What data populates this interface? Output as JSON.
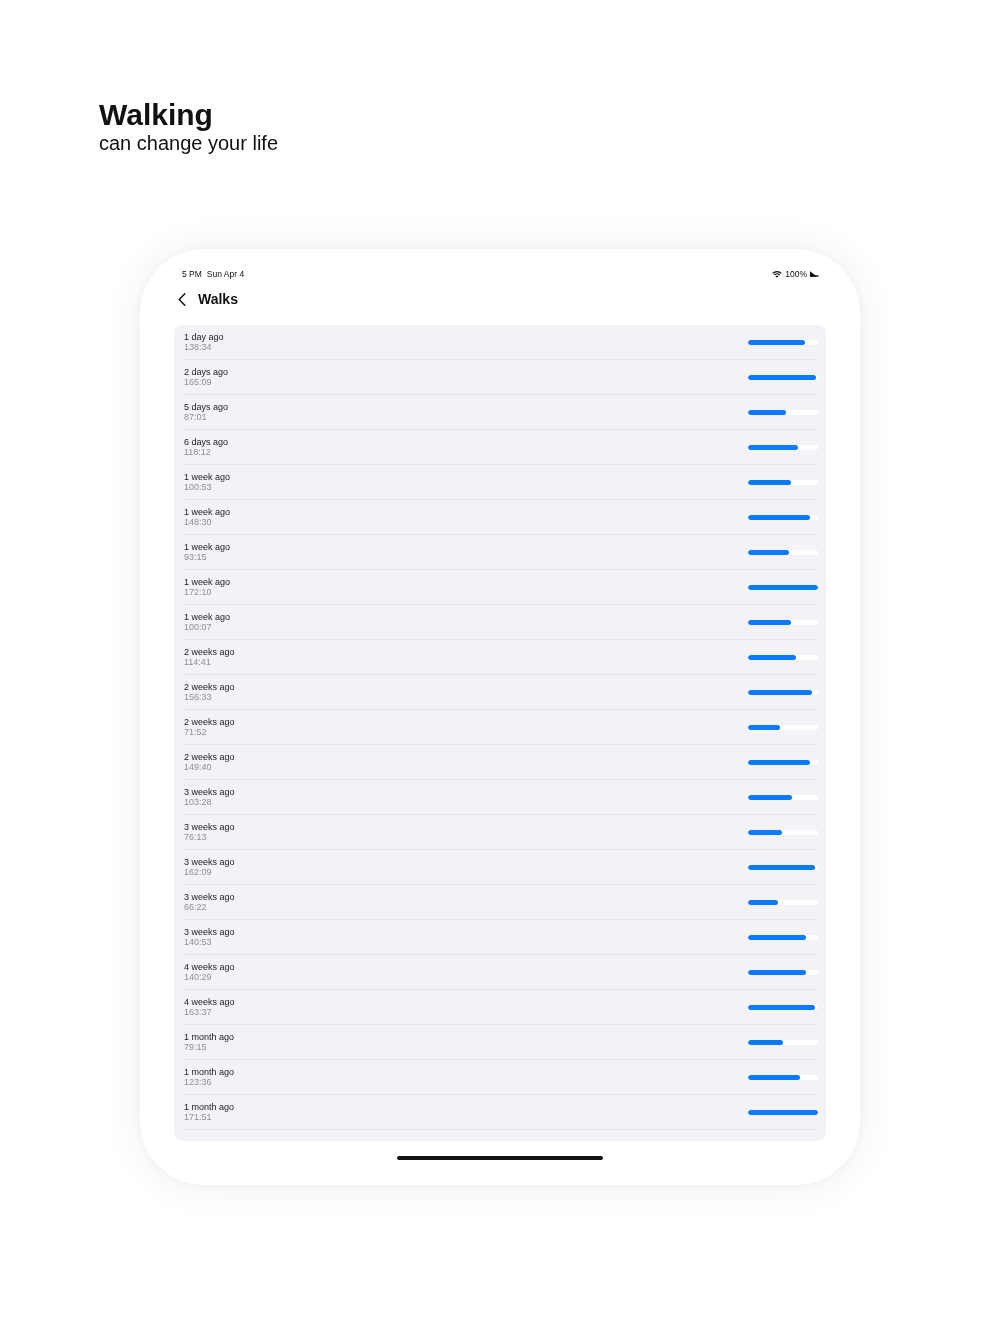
{
  "header": {
    "title": "Walking",
    "subtitle": "can change your life"
  },
  "status_bar": {
    "time": "5 PM",
    "date": "Sun Apr 4",
    "battery": "100%"
  },
  "nav": {
    "title": "Walks"
  },
  "walks": [
    {
      "when": "1 day ago",
      "duration": "138:34",
      "level": 0.82
    },
    {
      "when": "2 days ago",
      "duration": "165:09",
      "level": 0.97
    },
    {
      "when": "5 days ago",
      "duration": "87:01",
      "level": 0.54
    },
    {
      "when": "6 days ago",
      "duration": "118:12",
      "level": 0.71
    },
    {
      "when": "1 week ago",
      "duration": "100:53",
      "level": 0.62
    },
    {
      "when": "1 week ago",
      "duration": "148:30",
      "level": 0.88
    },
    {
      "when": "1 week ago",
      "duration": "93:15",
      "level": 0.58
    },
    {
      "when": "1 week ago",
      "duration": "172:10",
      "level": 1.0
    },
    {
      "when": "1 week ago",
      "duration": "100:07",
      "level": 0.61
    },
    {
      "when": "2 weeks ago",
      "duration": "114:41",
      "level": 0.69
    },
    {
      "when": "2 weeks ago",
      "duration": "156:33",
      "level": 0.92
    },
    {
      "when": "2 weeks ago",
      "duration": "71:52",
      "level": 0.46
    },
    {
      "when": "2 weeks ago",
      "duration": "149:40",
      "level": 0.88
    },
    {
      "when": "3 weeks ago",
      "duration": "103:28",
      "level": 0.63
    },
    {
      "when": "3 weeks ago",
      "duration": "76:13",
      "level": 0.48
    },
    {
      "when": "3 weeks ago",
      "duration": "162:09",
      "level": 0.95
    },
    {
      "when": "3 weeks ago",
      "duration": "66:22",
      "level": 0.43
    },
    {
      "when": "3 weeks ago",
      "duration": "140:53",
      "level": 0.83
    },
    {
      "when": "4 weeks ago",
      "duration": "140:29",
      "level": 0.83
    },
    {
      "when": "4 weeks ago",
      "duration": "163:37",
      "level": 0.96
    },
    {
      "when": "1 month ago",
      "duration": "79:15",
      "level": 0.5
    },
    {
      "when": "1 month ago",
      "duration": "123:36",
      "level": 0.74
    },
    {
      "when": "1 month ago",
      "duration": "171:51",
      "level": 1.0
    }
  ]
}
